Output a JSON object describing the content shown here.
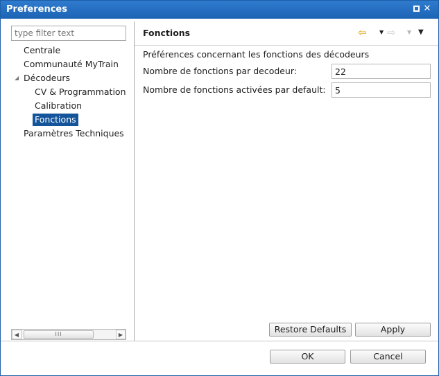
{
  "window": {
    "title": "Preferences",
    "maximize_icon": "maximize-icon",
    "close_label": "✕"
  },
  "filter": {
    "placeholder": "type filter text"
  },
  "tree": {
    "items": [
      {
        "label": "Centrale",
        "level": 0
      },
      {
        "label": "Communauté MyTrain",
        "level": 0
      },
      {
        "label": "Décodeurs",
        "level": 0,
        "expanded": true
      },
      {
        "label": "CV & Programmation",
        "level": 1
      },
      {
        "label": "Calibration",
        "level": 1
      },
      {
        "label": "Fonctions",
        "level": 1,
        "selected": true
      },
      {
        "label": "Paramètres Techniques",
        "level": 0
      }
    ]
  },
  "scrollbar": {
    "thumb_grip": "III"
  },
  "page": {
    "title": "Fonctions",
    "description": "Préférences concernant les fonctions des décodeurs",
    "fields": [
      {
        "label": "Nombre de fonctions par decodeur:",
        "value": "22"
      },
      {
        "label": "Nombre de fonctions activées par default:",
        "value": "5"
      }
    ]
  },
  "buttons": {
    "restore": "Restore Defaults",
    "apply": "Apply",
    "ok": "OK",
    "cancel": "Cancel"
  },
  "colors": {
    "titlebar": "#1c63b4",
    "selection": "#14549a",
    "back_arrow": "#e2a213"
  }
}
